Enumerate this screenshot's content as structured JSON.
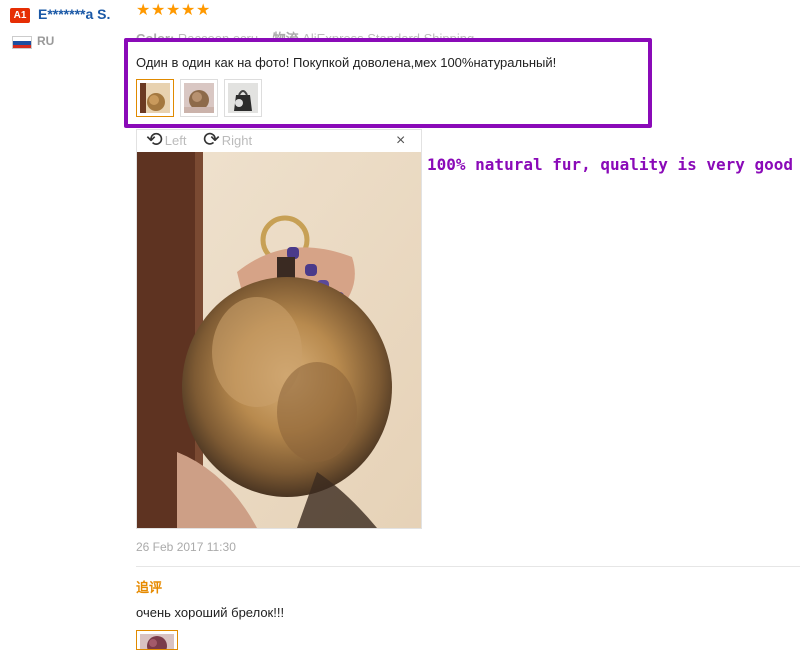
{
  "reviewer": {
    "level_badge": "A1",
    "name": "E*******a S.",
    "country_code": "RU",
    "rating_stars": 5
  },
  "review": {
    "sku_label": "Color:",
    "sku_value": "Raccoon ecru",
    "shipping_label": "物流",
    "shipping_value": "AliExpress Standard Shipping",
    "text": "Один в один как на фото! Покупкой доволена,мех 100%натуральный!",
    "date": "26 Feb 2017 11:30"
  },
  "viewer": {
    "rotate_left_label": "Left",
    "rotate_right_label": "Right",
    "close_label": "×"
  },
  "annotation": "100% natural fur, quality is very good",
  "followup": {
    "title": "追评",
    "text": "очень хороший брелок!!!"
  },
  "colors": {
    "highlight_border": "#8a0ab8",
    "username": "#1a58a6",
    "star": "#ff9900",
    "followup_title": "#e68a00"
  }
}
